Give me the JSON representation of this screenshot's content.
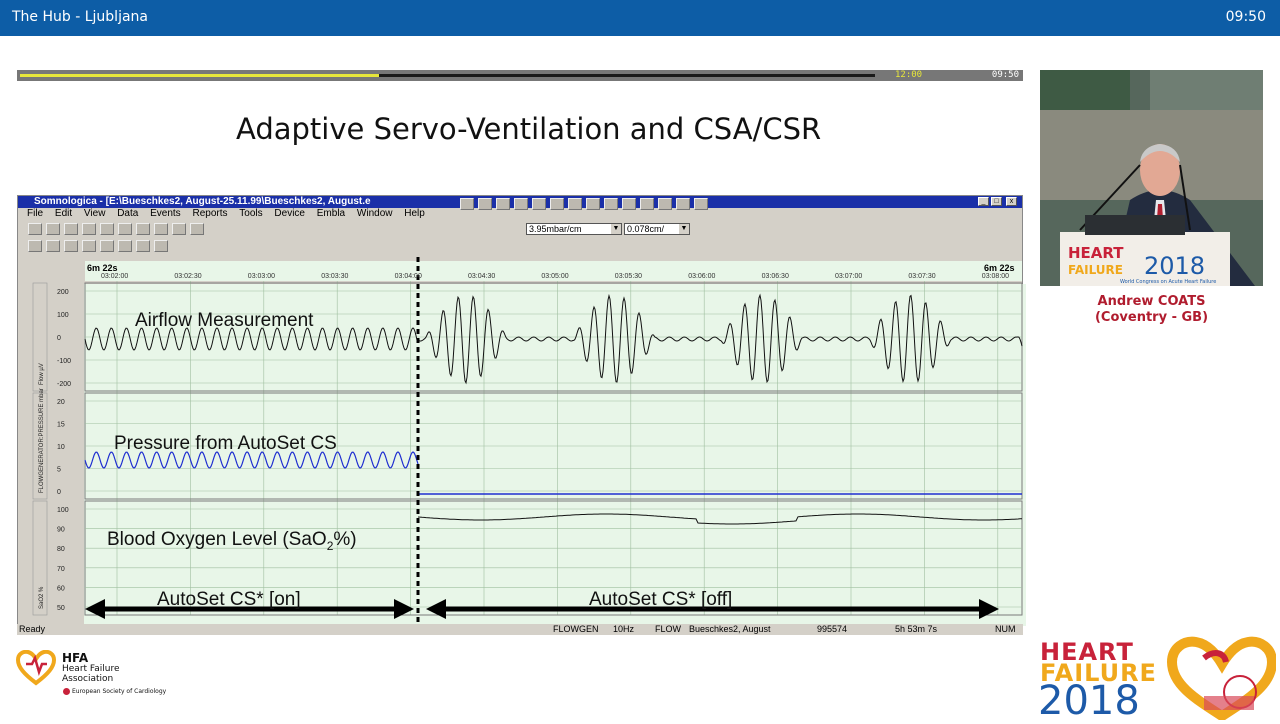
{
  "topbar": {
    "title": "The Hub - Ljubljana",
    "clock": "09:50"
  },
  "progress": {
    "total_time": "12:00",
    "elapsed_time": "09:50",
    "fraction": 0.42
  },
  "slide": {
    "title": "Adaptive Servo-Ventilation and CSA/CSR"
  },
  "app": {
    "window_title": "Somnologica - [E:\\Bueschkes2, August-25.11.99\\Bueschkes2, August.e",
    "menu": [
      "File",
      "Edit",
      "View",
      "Data",
      "Events",
      "Reports",
      "Tools",
      "Device",
      "Embla",
      "Window",
      "Help"
    ],
    "combo_scale": "3.95mbar/cm",
    "combo_speed": "0.078cm/",
    "time_start": "6m 22s",
    "time_end": "6m 22s",
    "time_ticks": [
      "03:02:00",
      "03:02:30",
      "03:03:00",
      "03:03:30",
      "03:04:00",
      "03:04:30",
      "03:05:00",
      "03:05:30",
      "03:06:00",
      "03:06:30",
      "03:07:00",
      "03:07:30",
      "03:08:00"
    ],
    "channels": [
      {
        "axis_label": "Flow µV",
        "ticks": [
          "200",
          "100",
          "0",
          "-100",
          "-200"
        ],
        "annotation": "Airflow Measurement",
        "color": "#111111"
      },
      {
        "axis_label": "FLOWGENERATOR:PRESSURE mbar",
        "ticks": [
          "20",
          "15",
          "10",
          "5",
          "0"
        ],
        "annotation": "Pressure from  AutoSet CS",
        "color": "#1f2fd0"
      },
      {
        "axis_label": "SaO2 %",
        "ticks": [
          "100",
          "90",
          "80",
          "70",
          "60",
          "50"
        ],
        "annotation_prefix": "Blood Oxygen Level (SaO",
        "annotation_sub": "2",
        "annotation_suffix": "%)",
        "color": "#111111"
      }
    ],
    "phase_on": "AutoSet CS*  [on]",
    "phase_off": "AutoSet CS*  [off]",
    "status": {
      "ready": "Ready",
      "channel": "FLOWGEN",
      "rate": "10Hz",
      "signal": "FLOW",
      "recording": "Bueschkes2, August",
      "sample": "995574",
      "duration": "5h 53m 7s",
      "mode": "NUM"
    }
  },
  "speaker": {
    "name": "Andrew COATS",
    "affiliation": "(Coventry - GB)"
  },
  "conference_banner": {
    "line1": "HEART",
    "line2": "FAILURE",
    "year": "2018",
    "tagline": "World Congress on Acute Heart Failure"
  },
  "hfa_logo": {
    "abbr": "HFA",
    "line1": "Heart Failure",
    "line2": "Association",
    "society": "European Society of Cardiology"
  },
  "conf_logo": {
    "line1": "HEART",
    "line2": "FAILURE",
    "year": "2018"
  }
}
